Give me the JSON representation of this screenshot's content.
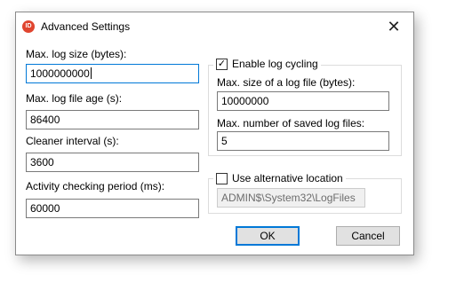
{
  "window": {
    "title": "Advanced Settings",
    "app_icon_text": "ID",
    "close_glyph": "✕"
  },
  "left": {
    "max_log_size": {
      "label": "Max. log size (bytes):",
      "value": "1000000000"
    },
    "max_log_age": {
      "label": "Max. log file age (s):",
      "value": "86400"
    },
    "cleaner_interval": {
      "label": "Cleaner interval (s):",
      "value": "3600"
    },
    "activity_period": {
      "label": "Activity checking period (ms):",
      "value": "60000"
    }
  },
  "log_cycling": {
    "checkbox_label": "Enable log cycling",
    "checked": true,
    "check_glyph": "✓",
    "max_size_label": "Max. size of a log file (bytes):",
    "max_size_value": "10000000",
    "max_saved_label": "Max. number of saved log files:",
    "max_saved_value": "5"
  },
  "alt_location": {
    "checkbox_label": "Use alternative location",
    "checked": false,
    "path_value": "ADMIN$\\System32\\LogFiles"
  },
  "buttons": {
    "ok": "OK",
    "cancel": "Cancel"
  },
  "colors": {
    "accent": "#0078d7",
    "app_icon": "#e0452f",
    "disabled_bg": "#f0f0f0"
  }
}
